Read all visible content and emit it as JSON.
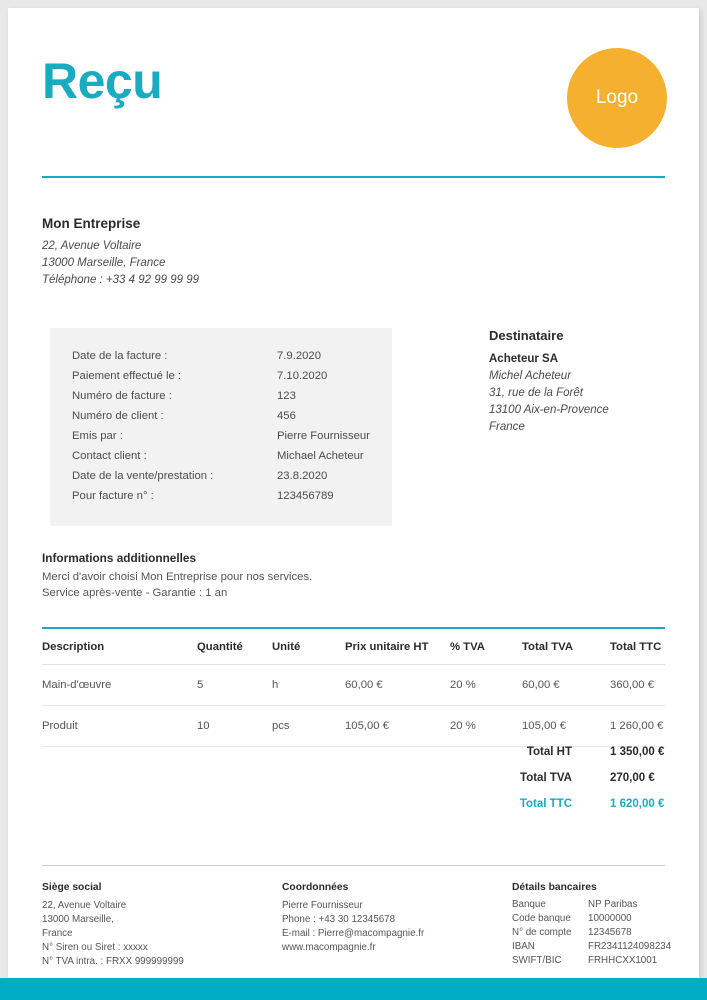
{
  "colors": {
    "accent_teal": "#1aabc0",
    "band_teal": "#00aec4",
    "logo_orange": "#f4b02e",
    "box_grey": "#f2f2f2"
  },
  "header": {
    "title": "Reçu",
    "logo_label": "Logo"
  },
  "issuer": {
    "name": "Mon Entreprise",
    "lines": [
      "22, Avenue Voltaire",
      "13000 Marseille, France",
      "Téléphone : +33 4 92 99 99 99"
    ]
  },
  "meta": {
    "rows": [
      {
        "label": "Date de la facture :",
        "value": "7.9.2020"
      },
      {
        "label": "Paiement effectué le :",
        "value": "7.10.2020"
      },
      {
        "label": "Numéro de facture :",
        "value": "123"
      },
      {
        "label": "Numéro de client :",
        "value": "456"
      },
      {
        "label": "Emis par :",
        "value": "Pierre Fournisseur"
      },
      {
        "label": "Contact client :",
        "value": "Michael Acheteur"
      },
      {
        "label": "Date de la vente/prestation :",
        "value": "23.8.2020"
      },
      {
        "label": "Pour facture n° :",
        "value": "123456789"
      }
    ]
  },
  "recipient": {
    "heading": "Destinataire",
    "company": "Acheteur SA",
    "lines": [
      "Michel Acheteur",
      "31, rue de la Forêt",
      "13100 Aix-en-Provence",
      "France"
    ]
  },
  "additional_info": {
    "heading": "Informations additionnelles",
    "lines": [
      "Merci d'avoir choisi Mon Entreprise pour nos services.",
      "Service après-vente - Garantie : 1 an"
    ]
  },
  "items_table": {
    "columns": [
      "Description",
      "Quantité",
      "Unité",
      "Prix unitaire HT",
      "% TVA",
      "Total TVA",
      "Total TTC"
    ],
    "rows": [
      {
        "description": "Main-d'œuvre",
        "quantity": "5",
        "unit": "h",
        "unit_price": "60,00 €",
        "vat_rate": "20 %",
        "total_vat": "60,00 €",
        "total_incl": "360,00 €"
      },
      {
        "description": "Produit",
        "quantity": "10",
        "unit": "pcs",
        "unit_price": "105,00 €",
        "vat_rate": "20 %",
        "total_vat": "105,00 €",
        "total_incl": "1 260,00 €"
      }
    ]
  },
  "totals": [
    {
      "label": "Total HT",
      "value": "1 350,00 €",
      "accent": false
    },
    {
      "label": "Total TVA",
      "value": "270,00 €",
      "accent": false
    },
    {
      "label": "Total TTC",
      "value": "1 620,00 €",
      "accent": true
    }
  ],
  "footer": {
    "registered_office": {
      "heading": "Siège social",
      "lines": [
        "22, Avenue Voltaire",
        "13000 Marseille,",
        "France",
        "N° Siren ou Siret : xxxxx",
        "N° TVA intra. : FRXX 999999999"
      ]
    },
    "contact": {
      "heading": "Coordonnées",
      "lines": [
        "Pierre Fournisseur",
        "Phone : +43 30 12345678",
        "E-mail : Pierre@macompagnie.fr",
        "www.macompagnie.fr"
      ]
    },
    "bank": {
      "heading": "Détails bancaires",
      "rows": [
        {
          "key": "Banque",
          "value": "NP Paribas"
        },
        {
          "key": "Code banque",
          "value": "10000000"
        },
        {
          "key": "N° de compte",
          "value": "12345678"
        },
        {
          "key": "IBAN",
          "value": "FR2341124098234"
        },
        {
          "key": "SWIFT/BIC",
          "value": "FRHHCXX1001"
        }
      ]
    }
  }
}
